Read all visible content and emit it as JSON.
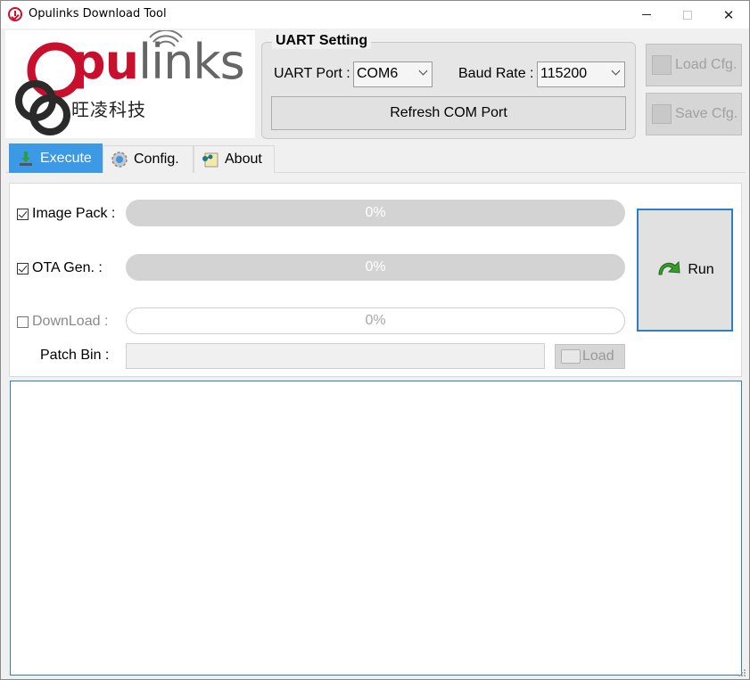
{
  "window": {
    "title": "Opulinks Download Tool",
    "controls": {
      "minimize": "minimize",
      "maximize": "maximize",
      "close": "✕"
    }
  },
  "logo": {
    "brand_colored": "pu",
    "brand_gray": "links",
    "chinese_name": "旺凌科技"
  },
  "uart": {
    "legend": "UART Setting",
    "port_label": "UART Port :",
    "port_value": "COM6",
    "baud_label": "Baud Rate :",
    "baud_value": "115200",
    "refresh_label": "Refresh COM Port"
  },
  "side_buttons": {
    "load_cfg": "Load Cfg.",
    "save_cfg": "Save Cfg."
  },
  "tabs": [
    {
      "label": "Execute",
      "icon": "download-icon",
      "active": true
    },
    {
      "label": "Config.",
      "icon": "gear-icon",
      "active": false
    },
    {
      "label": "About",
      "icon": "network-note-icon",
      "active": false
    }
  ],
  "execute": {
    "rows": [
      {
        "label": "Image Pack :",
        "checked": true,
        "enabled": true,
        "progress": 0,
        "progress_text": "0%"
      },
      {
        "label": "OTA Gen. :",
        "checked": true,
        "enabled": true,
        "progress": 0,
        "progress_text": "0%"
      },
      {
        "label": "DownLoad :",
        "checked": false,
        "enabled": false,
        "progress": 0,
        "progress_text": "0%"
      }
    ],
    "patch_label": "Patch Bin :",
    "patch_value": "",
    "patch_load_label": "Load",
    "run_label": "Run"
  },
  "log": {
    "content": ""
  },
  "colors": {
    "accent": "#3c99e6",
    "brand_red": "#c8102e",
    "run_border": "#2c7fc4",
    "progress_track": "#d3d3d3"
  }
}
